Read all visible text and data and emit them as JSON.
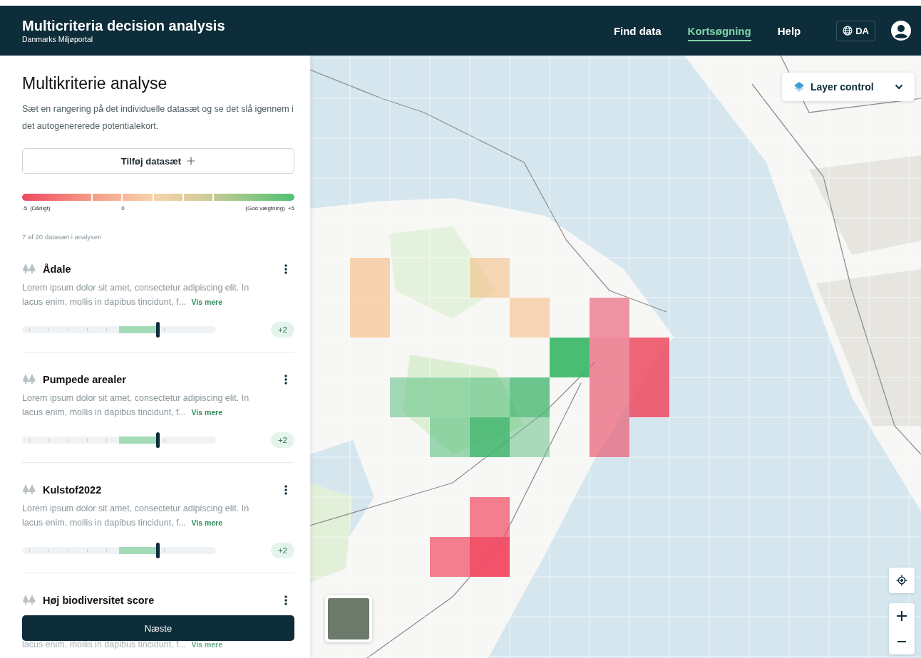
{
  "header": {
    "title": "Multicriteria decision analysis",
    "subtitle": "Danmarks Miljøportal",
    "nav": [
      {
        "label": "Find data",
        "selected": false
      },
      {
        "label": "Kortsøgning",
        "selected": true
      },
      {
        "label": "Help",
        "selected": false
      }
    ],
    "language": "DA"
  },
  "sidebar": {
    "heading": "Multikriterie analyse",
    "intro": "Sæt en rangering på det individuelle datasæt og se det slå igennem i det autogenererede potentialekort.",
    "add_button": "Tilføj datasæt",
    "scale": {
      "min_label": "-5",
      "min_note": "(Dårligt)",
      "mid_label": "0",
      "max_note": "(God vægtning)",
      "max_label": "+5"
    },
    "count": "7 af 20 datasæt i analysen",
    "datasets": [
      {
        "title": "Ådale",
        "description": "Lorem ipsum dolor sit amet, consectetur adipiscing elit. In lacus enim, mollis in dapibus tincidunt, f...",
        "more": "Vis mere",
        "level": 0.7,
        "value": "+2"
      },
      {
        "title": "Pumpede arealer",
        "description": "Lorem ipsum dolor sit amet, consectetur adipiscing elit. In lacus enim, mollis in dapibus tincidunt, f...",
        "more": "Vis mere",
        "level": 0.7,
        "value": "+2"
      },
      {
        "title": "Kulstof2022",
        "description": "Lorem ipsum dolor sit amet, consectetur adipiscing elit. In lacus enim, mollis in dapibus tincidunt, f...",
        "more": "Vis mere",
        "level": 0.7,
        "value": "+2"
      },
      {
        "title": "Høj biodiversitet score",
        "description": "lacus enim, mollis in dapibus tincidunt, f...",
        "more": "Vis mere"
      }
    ],
    "next_button": "Næste"
  },
  "map": {
    "layer_control": "Layer control"
  }
}
